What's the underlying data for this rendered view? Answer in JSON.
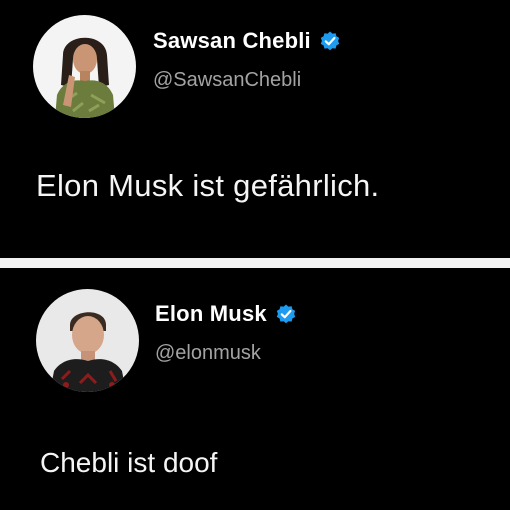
{
  "tweets": [
    {
      "display_name": "Sawsan Chebli",
      "handle": "@SawsanChebli",
      "text": "Elon Musk ist gefährlich.",
      "verified_icon": "verified-badge-icon",
      "avatar": "woman-portrait"
    },
    {
      "display_name": "Elon Musk",
      "handle": "@elonmusk",
      "text": "Chebli ist doof",
      "verified_icon": "verified-badge-icon",
      "avatar": "man-portrait"
    }
  ],
  "colors": {
    "background": "#000000",
    "divider": "#f2f2f2",
    "name_text": "#ffffff",
    "handle_text": "#a3a3a3",
    "verified_badge": "#1d9bf0"
  }
}
